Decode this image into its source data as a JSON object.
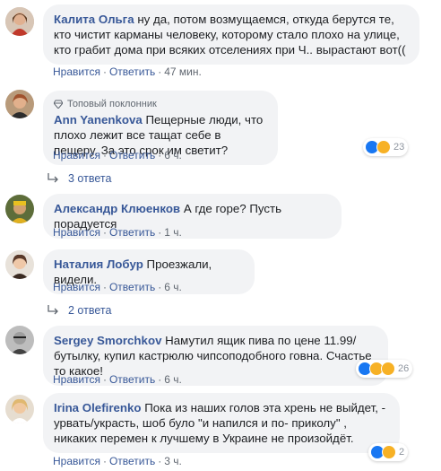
{
  "comments": [
    {
      "author": "Калита Ольга",
      "text": "ну да, потом возмущаемся, откуда берутся те, кто чистит карманы человеку, которому стало плохо на улице, кто грабит дома при всяких отселениях при Ч.. вырастают вот((",
      "like": "Нравится",
      "reply": "Ответить",
      "time": "47 мин."
    },
    {
      "badge": "Топовый поклонник",
      "author": "Ann Yanenkova",
      "text": "Пещерные люди, что плохо лежит все тащат себе в пещеру. За это срок им светит?",
      "like": "Нравится",
      "reply": "Ответить",
      "time": "6 ч.",
      "reaction_count": "23",
      "replies": "3 ответа"
    },
    {
      "author": "Александр Клюенков",
      "text": "А где горе? Пусть порадуется",
      "like": "Нравится",
      "reply": "Ответить",
      "time": "1 ч."
    },
    {
      "author": "Наталия Лобур",
      "text": "Проезжали, видели.",
      "like": "Нравится",
      "reply": "Ответить",
      "time": "6 ч.",
      "replies": "2 ответа"
    },
    {
      "author": "Sergey Smorchkov",
      "text": "Намутил ящик пива по цене 11.99/бутылку, купил кастрюлю чипсоподобного говна. Счастье то какое!",
      "like": "Нравится",
      "reply": "Ответить",
      "time": "6 ч.",
      "reaction_count": "26"
    },
    {
      "author": "Irina Olefirenko",
      "text": "Пока из наших голов эта хрень не выйдет, - урвать/украсть, шоб було \"и напился и по- приколу\" , никаких перемен к лучшему в Украине не произойдёт.",
      "like": "Нравится",
      "reply": "Ответить",
      "time": "3 ч.",
      "reaction_count": "2"
    }
  ],
  "separator": "·",
  "colors": {
    "author": "#385898",
    "bubble": "#f2f3f5",
    "meta": "#606770"
  }
}
